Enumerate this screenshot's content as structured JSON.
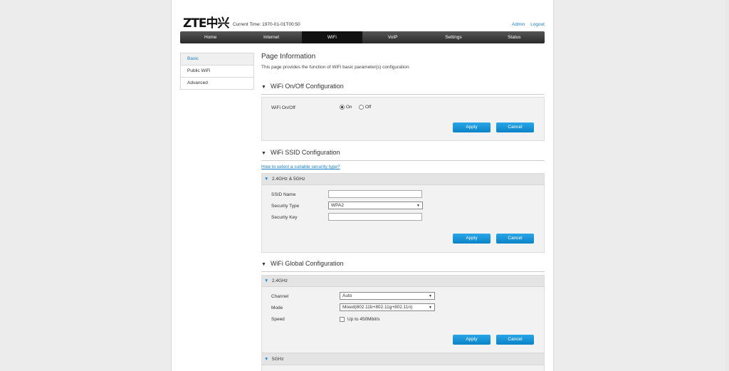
{
  "header": {
    "logo": "ZTE中兴",
    "current_time_label": "Current Time: 1970-01-01T00:50",
    "admin": "Admin",
    "logout": "Logout"
  },
  "nav": [
    "Home",
    "Internet",
    "WiFi",
    "VoIP",
    "Settings",
    "Status"
  ],
  "sidebar": [
    "Basic",
    "Public WiFi",
    "Advanced"
  ],
  "page": {
    "title": "Page Information",
    "desc": "This page provides the function of WiFi basic parameter(s) configuration."
  },
  "onoff": {
    "title": "WiFi On/Off Configuration",
    "label": "WiFi On/Off",
    "on": "On",
    "off": "Off",
    "selected": "On"
  },
  "ssid": {
    "title": "WiFi SSID Configuration",
    "help": "How to select a suitable security type?",
    "band": "2.4GHz & 5GHz",
    "ssid_label": "SSID Name",
    "ssid_value": "",
    "sec_label": "Security Type",
    "sec_value": "WPA2",
    "key_label": "Security Key",
    "key_value": ""
  },
  "global": {
    "title": "WiFi Global Configuration",
    "band24": "2.4GHz",
    "channel_label": "Channel",
    "channel_value": "Auto",
    "mode_label": "Mode",
    "mode_value": "Mixed(802.11b+802.11g+802.11n)",
    "speed_label": "Speed",
    "speed_option": "Up to 450Mbit/s",
    "band5": "5GHz"
  },
  "buttons": {
    "apply": "Apply",
    "cancel": "Cancel"
  },
  "colors": {
    "accent": "#1a8fd6",
    "link": "#1a7fcf"
  }
}
